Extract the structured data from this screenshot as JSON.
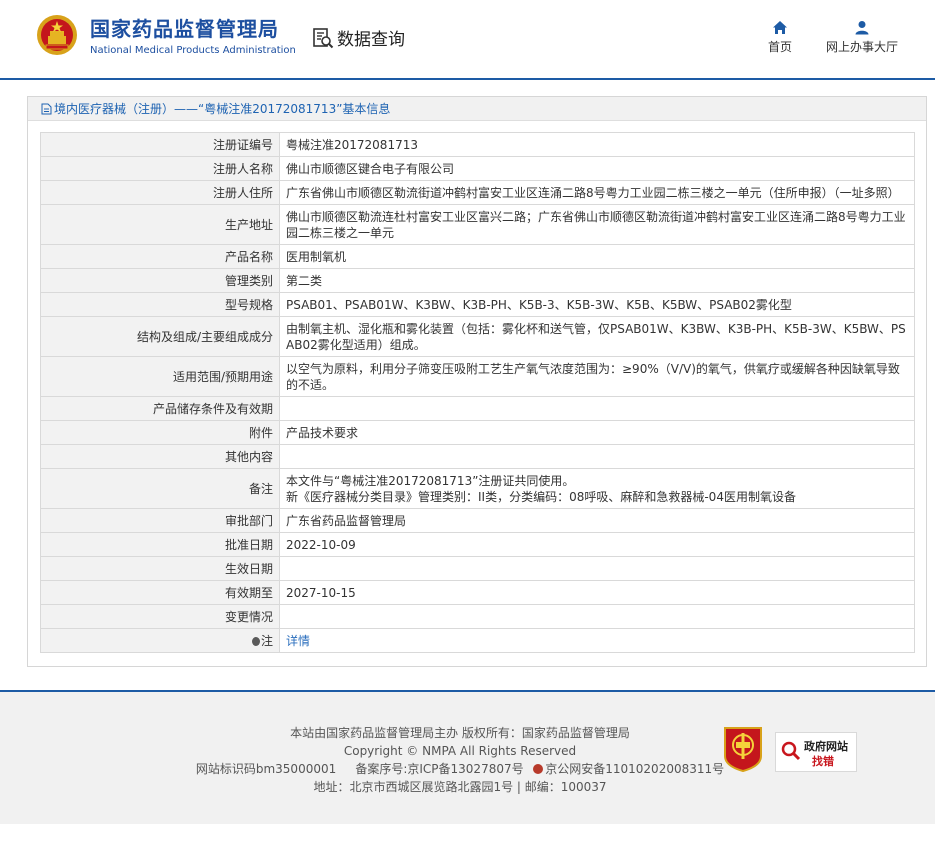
{
  "header": {
    "brand_cn": "国家药品监督管理局",
    "brand_en": "National Medical Products Administration",
    "query_label": "数据查询",
    "nav": [
      {
        "label": "首页",
        "icon": "home-icon"
      },
      {
        "label": "网上办事大厅",
        "icon": "user-icon"
      }
    ]
  },
  "panel": {
    "title": "境内医疗器械（注册）——“粤械注准20172081713”基本信息",
    "rows": [
      {
        "label": "注册证编号",
        "value": "粤械注准20172081713"
      },
      {
        "label": "注册人名称",
        "value": "佛山市顺德区键合电子有限公司"
      },
      {
        "label": "注册人住所",
        "value": "广东省佛山市顺德区勒流街道冲鹤村富安工业区连涌二路8号粤力工业园二栋三楼之一单元（住所申报）（一址多照）"
      },
      {
        "label": "生产地址",
        "value": "佛山市顺德区勒流连杜村富安工业区富兴二路；广东省佛山市顺德区勒流街道冲鹤村富安工业区连涌二路8号粤力工业园二栋三楼之一单元"
      },
      {
        "label": "产品名称",
        "value": "医用制氧机"
      },
      {
        "label": "管理类别",
        "value": "第二类"
      },
      {
        "label": "型号规格",
        "value": "PSAB01、PSAB01W、K3BW、K3B-PH、K5B-3、K5B-3W、K5B、K5BW、PSAB02雾化型"
      },
      {
        "label": "结构及组成/主要组成成分",
        "value": "由制氧主机、湿化瓶和雾化装置（包括：雾化杯和送气管，仅PSAB01W、K3BW、K3B-PH、K5B-3W、K5BW、PSAB02雾化型适用）组成。"
      },
      {
        "label": "适用范围/预期用途",
        "value": "以空气为原料，利用分子筛变压吸附工艺生产氧气浓度范围为：≥90%（V/V)的氧气，供氧疗或缓解各种因缺氧导致的不适。"
      },
      {
        "label": "产品储存条件及有效期",
        "value": ""
      },
      {
        "label": "附件",
        "value": "产品技术要求"
      },
      {
        "label": "其他内容",
        "value": ""
      },
      {
        "label": "备注",
        "value_line1": "本文件与“粤械注准20172081713”注册证共同使用。",
        "value_line2": "新《医疗器械分类目录》管理类别：II类，分类编码：08呼吸、麻醉和急救器械-04医用制氧设备"
      },
      {
        "label": "审批部门",
        "value": "广东省药品监督管理局"
      },
      {
        "label": "批准日期",
        "value": "2022-10-09"
      },
      {
        "label": "生效日期",
        "value": ""
      },
      {
        "label": "有效期至",
        "value": "2027-10-15"
      },
      {
        "label": "变更情况",
        "value": ""
      },
      {
        "label": "注",
        "value": "详情"
      }
    ]
  },
  "footer": {
    "line1": "本站由国家药品监督管理局主办 版权所有：国家药品监督管理局",
    "line2": "Copyright © NMPA All Rights Reserved",
    "line3_a": "网站标识码bm35000001",
    "line3_b": "备案序号:京ICP备13027807号",
    "line3_c": "京公网安备11010202008311号",
    "line4": "地址：北京市西城区展览路北露园1号 | 邮编：100037",
    "badge2_title": "政府网站",
    "badge2_sub": "找错"
  }
}
